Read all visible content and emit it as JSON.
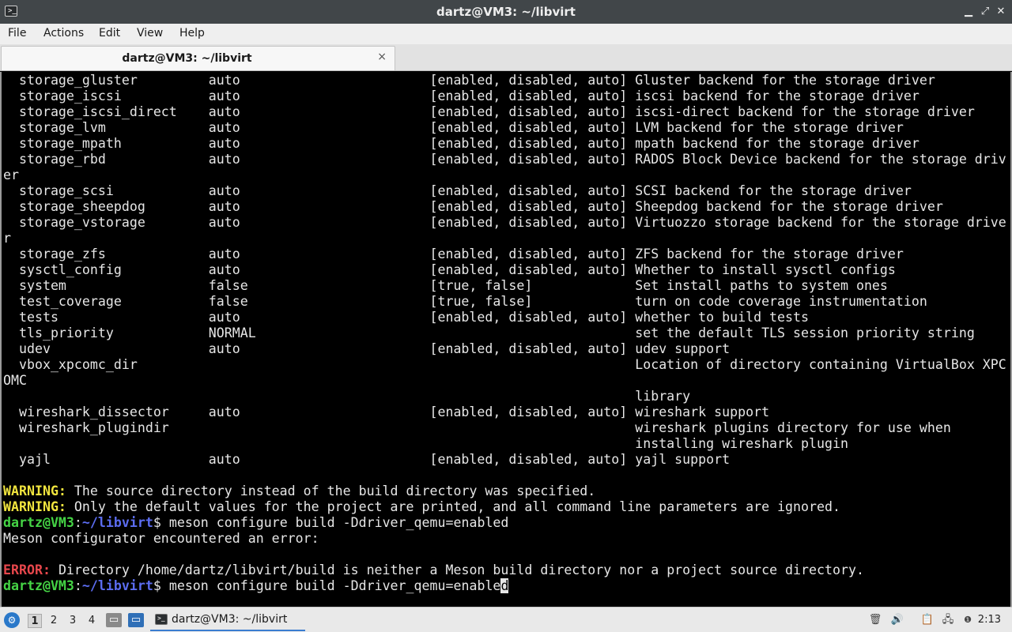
{
  "window": {
    "title": "dartz@VM3: ~/libvirt",
    "controls": {
      "minimize": "▁",
      "maximize": "⤢",
      "close": "✕"
    }
  },
  "menu": [
    "File",
    "Actions",
    "Edit",
    "View",
    "Help"
  ],
  "tab": {
    "label": "dartz@VM3: ~/libvirt",
    "close": "×"
  },
  "terminal": {
    "colors": {
      "user": "#45d445",
      "path": "#5b6cf0",
      "warning": "#f0e43e",
      "error": "#e8474c"
    },
    "lines": [
      {
        "text": "  storage_gluster         auto                        [enabled, disabled, auto] Gluster backend for the storage driver"
      },
      {
        "text": "  storage_iscsi           auto                        [enabled, disabled, auto] iscsi backend for the storage driver"
      },
      {
        "text": "  storage_iscsi_direct    auto                        [enabled, disabled, auto] iscsi-direct backend for the storage driver"
      },
      {
        "text": "  storage_lvm             auto                        [enabled, disabled, auto] LVM backend for the storage driver"
      },
      {
        "text": "  storage_mpath           auto                        [enabled, disabled, auto] mpath backend for the storage driver"
      },
      {
        "text": "  storage_rbd             auto                        [enabled, disabled, auto] RADOS Block Device backend for the storage driv"
      },
      {
        "text": "er"
      },
      {
        "text": "  storage_scsi            auto                        [enabled, disabled, auto] SCSI backend for the storage driver"
      },
      {
        "text": "  storage_sheepdog        auto                        [enabled, disabled, auto] Sheepdog backend for the storage driver"
      },
      {
        "text": "  storage_vstorage        auto                        [enabled, disabled, auto] Virtuozzo storage backend for the storage drive"
      },
      {
        "text": "r"
      },
      {
        "text": "  storage_zfs             auto                        [enabled, disabled, auto] ZFS backend for the storage driver"
      },
      {
        "text": "  sysctl_config           auto                        [enabled, disabled, auto] Whether to install sysctl configs"
      },
      {
        "text": "  system                  false                       [true, false]             Set install paths to system ones"
      },
      {
        "text": "  test_coverage           false                       [true, false]             turn on code coverage instrumentation"
      },
      {
        "text": "  tests                   auto                        [enabled, disabled, auto] whether to build tests"
      },
      {
        "text": "  tls_priority            NORMAL                                                set the default TLS session priority string"
      },
      {
        "text": "  udev                    auto                        [enabled, disabled, auto] udev support"
      },
      {
        "text": "  vbox_xpcomc_dir                                                               Location of directory containing VirtualBox XPC"
      },
      {
        "text": "OMC"
      },
      {
        "text": "                                                                                library"
      },
      {
        "text": "  wireshark_dissector     auto                        [enabled, disabled, auto] wireshark support"
      },
      {
        "text": "  wireshark_plugindir                                                           wireshark plugins directory for use when"
      },
      {
        "text": "                                                                                installing wireshark plugin"
      },
      {
        "text": "  yajl                    auto                        [enabled, disabled, auto] yajl support"
      },
      {
        "text": ""
      },
      {
        "kind": "warning",
        "label": "WARNING:",
        "text": " The source directory instead of the build directory was specified."
      },
      {
        "kind": "warning",
        "label": "WARNING:",
        "text": " Only the default values for the project are printed, and all command line parameters are ignored."
      },
      {
        "kind": "prompt",
        "user": "dartz@VM3",
        "sep": ":",
        "path": "~/libvirt",
        "sign": "$",
        "cmd": " meson configure build -Ddriver_qemu=enabled"
      },
      {
        "text": "Meson configurator encountered an error:"
      },
      {
        "text": ""
      },
      {
        "kind": "error",
        "label": "ERROR:",
        "text": " Directory /home/dartz/libvirt/build is neither a Meson build directory nor a project source directory."
      },
      {
        "kind": "prompt",
        "user": "dartz@VM3",
        "sep": ":",
        "path": "~/libvirt",
        "sign": "$",
        "cmd": " meson configure build -Ddriver_qemu=enable",
        "cursor": "d"
      }
    ]
  },
  "taskbar": {
    "workspaces": [
      "1",
      "2",
      "3",
      "4"
    ],
    "active_workspace": "1",
    "task_label": "dartz@VM3: ~/libvirt",
    "tray_icons": [
      "trash-icon",
      "volume-icon",
      "clipboard-icon",
      "network-icon",
      "notification-icon"
    ],
    "clock": "2:13"
  }
}
